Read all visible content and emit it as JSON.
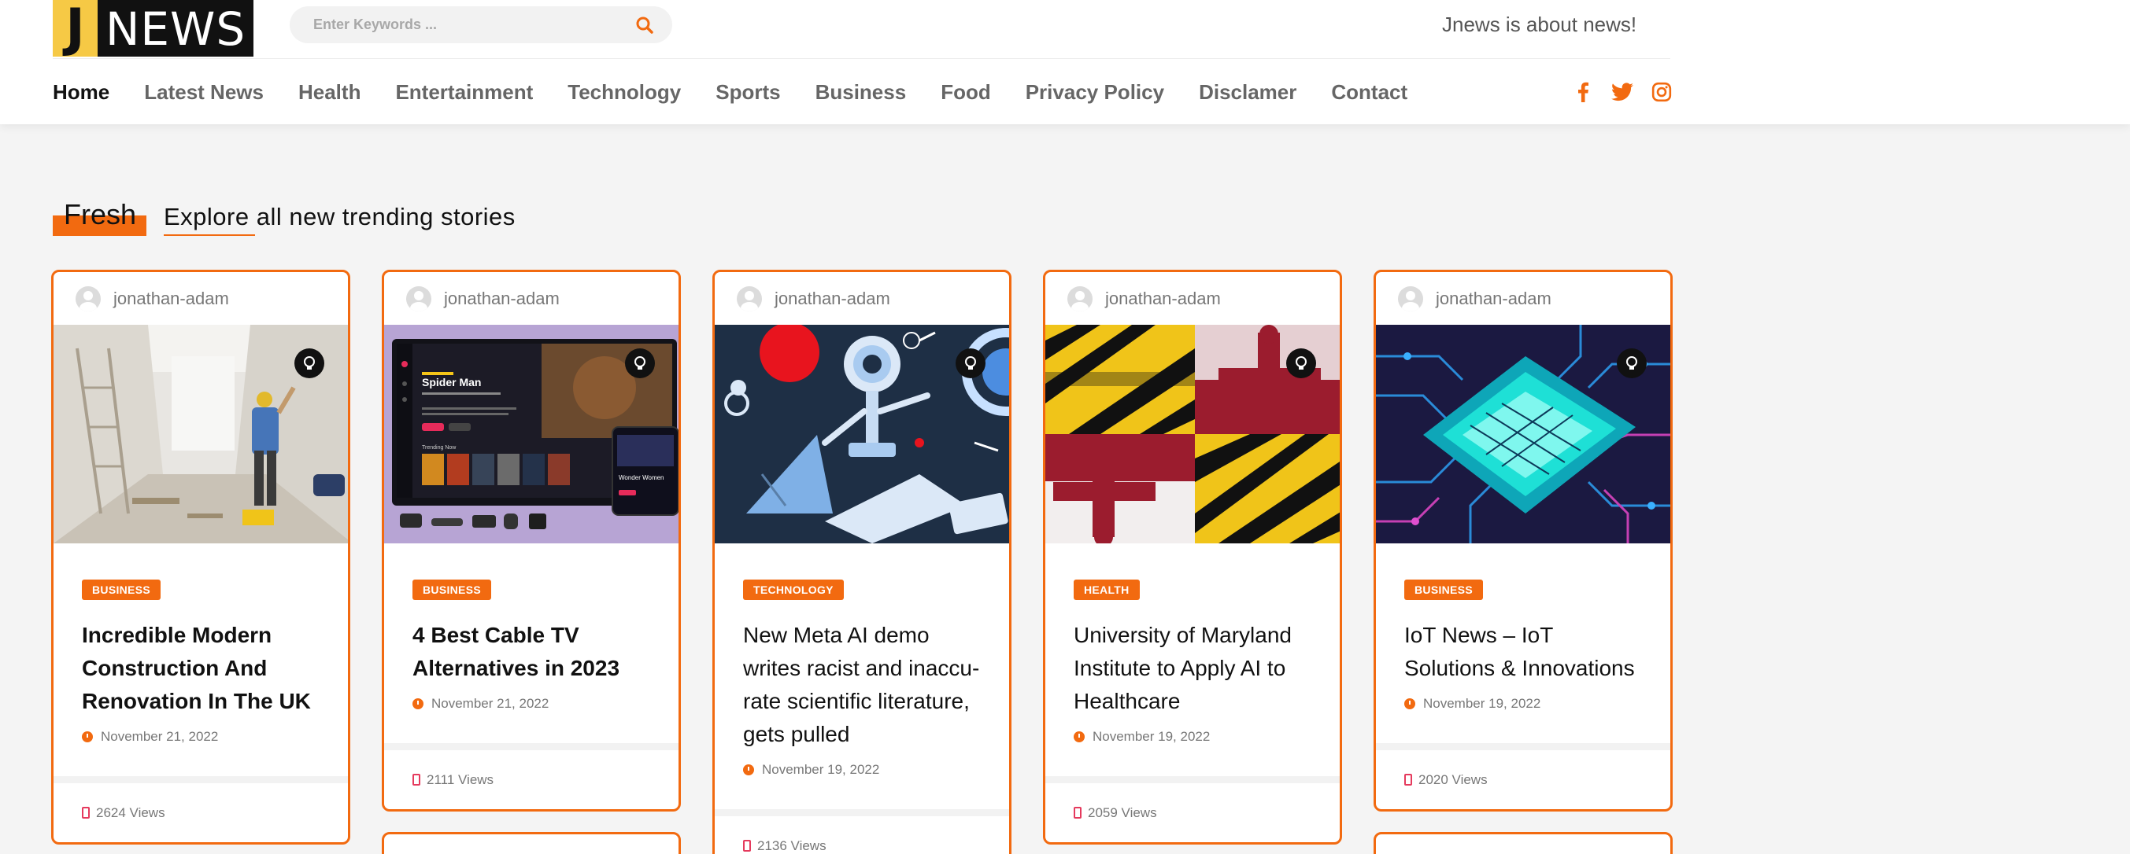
{
  "brand": {
    "logo_letter": "J",
    "logo_word": "NEWS",
    "tagline": "Jnews is about news!"
  },
  "search": {
    "placeholder": "Enter Keywords ...",
    "value": ""
  },
  "nav": {
    "items": [
      {
        "label": "Home",
        "active": true
      },
      {
        "label": "Latest News"
      },
      {
        "label": "Health"
      },
      {
        "label": "Entertainment"
      },
      {
        "label": "Technology"
      },
      {
        "label": "Sports"
      },
      {
        "label": "Business"
      },
      {
        "label": "Food"
      },
      {
        "label": "Privacy Policy"
      },
      {
        "label": "Disclamer"
      },
      {
        "label": "Contact"
      }
    ]
  },
  "social": [
    "facebook-icon",
    "twitter-icon",
    "instagram-icon"
  ],
  "section": {
    "label": "Fresh",
    "subtitle": "Explore all new trending stories"
  },
  "colors": {
    "accent": "#f26a10",
    "logo_yellow": "#f6c945",
    "views_icon": "#e53a5d"
  },
  "cards": [
    {
      "author": "jonathan-adam",
      "category": "BUSINESS",
      "title": "Incredible Modern Construction And Renovation In The UK",
      "date": "November 21, 2022",
      "views": "2624 Views",
      "title_bold": true
    },
    {
      "author": "jonathan-adam",
      "category": "BUSINESS",
      "title": "4 Best Cable TV Alternatives in 2023",
      "date": "November 21, 2022",
      "views": "2111 Views",
      "title_bold": true,
      "image_text": {
        "movie": "Spider Man",
        "side": "Wonder Women",
        "trending": "Trending Now"
      }
    },
    {
      "author": "jonathan-adam",
      "category": "TECHNOLOGY",
      "title": "New Meta AI demo writes racist and inaccu-rate scientific literature, gets pulled",
      "date": "November 19, 2022",
      "views": "2136 Views",
      "title_bold": false
    },
    {
      "author": "jonathan-adam",
      "category": "HEALTH",
      "title": "University of Maryland Institute to Apply AI to Healthcare",
      "date": "November 19, 2022",
      "views": "2059 Views",
      "title_bold": false
    },
    {
      "author": "jonathan-adam",
      "category": "BUSINESS",
      "title": "IoT News – IoT Solutions & Innovations",
      "date": "November 19, 2022",
      "views": "2020 Views",
      "title_bold": false
    }
  ]
}
